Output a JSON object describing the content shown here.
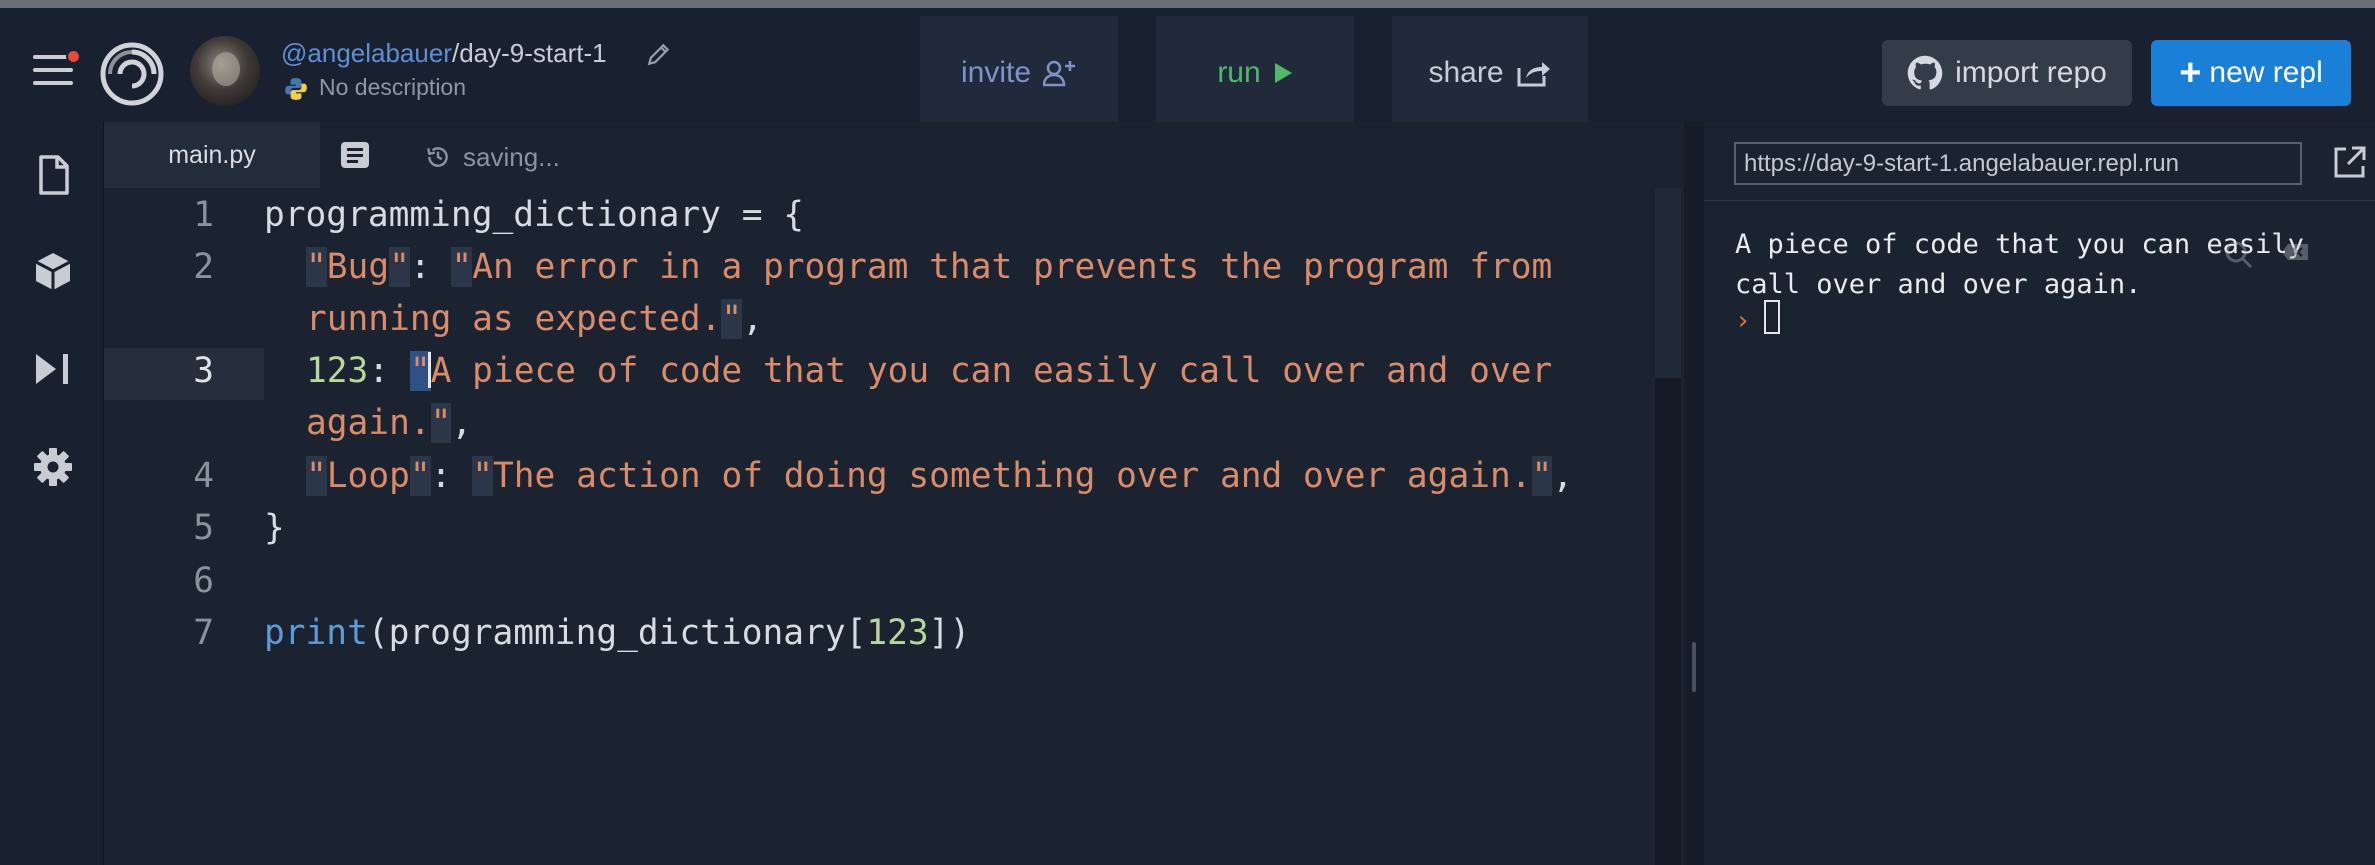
{
  "header": {
    "username": "@angelabauer",
    "separator": "/",
    "repl_name": "day-9-start-1",
    "description": "No description",
    "invite_label": "invite",
    "run_label": "run",
    "share_label": "share",
    "import_label": "import repo",
    "new_repl_label": "new repl",
    "new_repl_plus": "+"
  },
  "sidebar": {
    "items": [
      "files-icon",
      "packages-icon",
      "debugger-icon",
      "settings-icon"
    ]
  },
  "editor": {
    "tab_label": "main.py",
    "status": "saving...",
    "line_numbers": [
      "1",
      "2",
      "3",
      "4",
      "5",
      "6",
      "7"
    ],
    "lines": {
      "l1": "programming_dictionary = {",
      "l2_key": "Bug",
      "l2_val_a": "An error in a program that prevents the program from",
      "l2_val_b": "running as expected.",
      "l3_key": "123",
      "l3_val_a": "A piece of code that you can easily call over and over",
      "l3_val_b": "again.",
      "l4_key": "Loop",
      "l4_val": "The action of doing something over and over again.",
      "l5": "}",
      "l7_fn": "print",
      "l7_arg": "(programming_dictionary[",
      "l7_num": "123",
      "l7_end": "])"
    }
  },
  "console": {
    "url": "https://day-9-start-1.angelabauer.repl.run",
    "output_line1": "A piece of code that you can easily",
    "output_line2": "call over and over again.",
    "prompt": "›"
  },
  "colors": {
    "background": "#1b2330",
    "string": "#d98b6a",
    "number": "#b7d89a",
    "function": "#5d9cd8",
    "run_accent": "#42b35e",
    "primary_button": "#1a7fd6"
  }
}
